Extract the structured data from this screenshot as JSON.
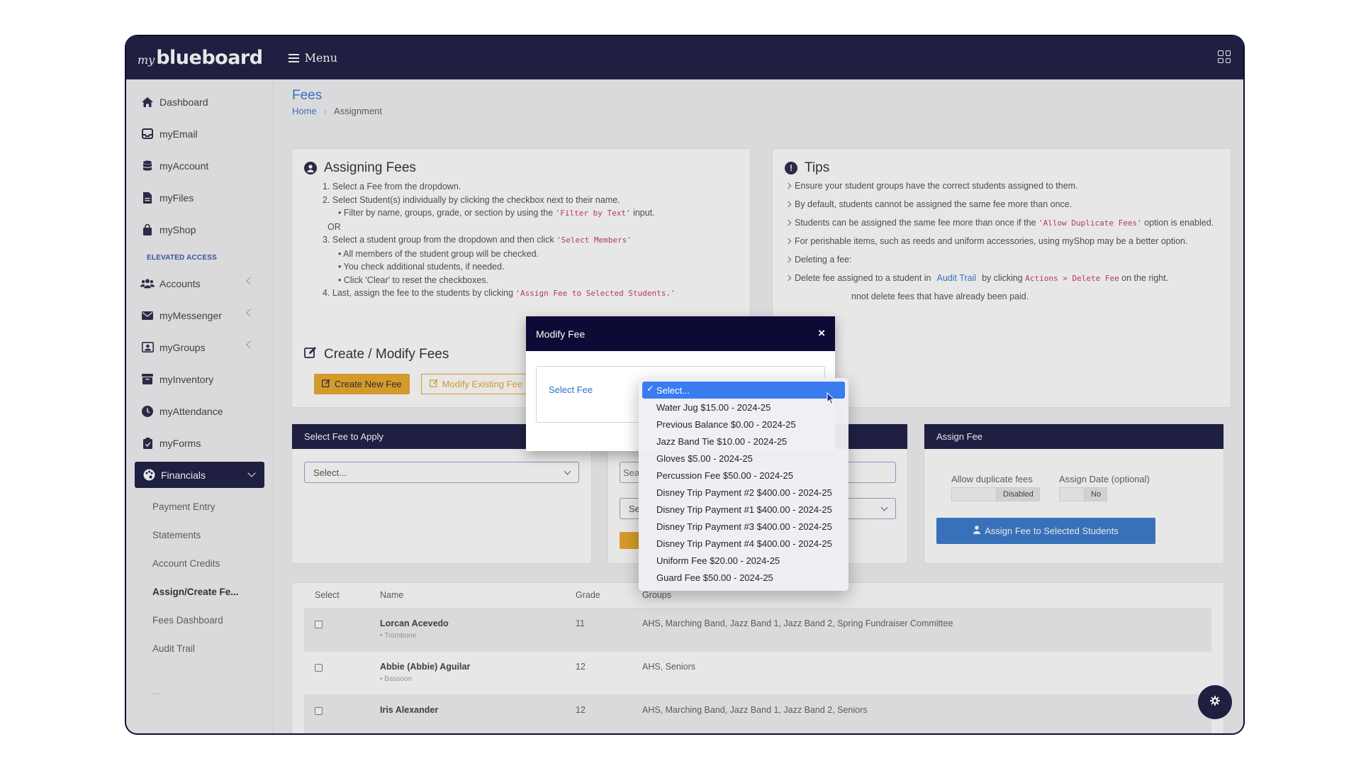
{
  "app": {
    "logo_my": "my",
    "logo_main": "blueboard",
    "menu_label": "Menu"
  },
  "sidebar": {
    "items": [
      {
        "label": "Dashboard",
        "icon": "home-icon"
      },
      {
        "label": "myEmail",
        "icon": "inbox-icon"
      },
      {
        "label": "myAccount",
        "icon": "database-icon"
      },
      {
        "label": "myFiles",
        "icon": "file-icon"
      },
      {
        "label": "myShop",
        "icon": "bag-icon"
      }
    ],
    "elevated_heading": "ELEVATED ACCESS",
    "elevated_items": [
      {
        "label": "Accounts",
        "icon": "users-icon"
      },
      {
        "label": "myMessenger",
        "icon": "envelope-icon"
      },
      {
        "label": "myGroups",
        "icon": "group-icon"
      },
      {
        "label": "myInventory",
        "icon": "archive-icon"
      },
      {
        "label": "myAttendance",
        "icon": "clock-icon"
      },
      {
        "label": "myForms",
        "icon": "clipboard-icon"
      }
    ],
    "active": {
      "label": "Financials",
      "icon": "palette-icon"
    },
    "sub_items": [
      "Payment Entry",
      "Statements",
      "Account Credits",
      "Assign/Create Fe...",
      "Fees Dashboard",
      "Audit Trail"
    ],
    "more": "..."
  },
  "page": {
    "title": "Fees",
    "breadcrumb_home": "Home",
    "breadcrumb_current": "Assignment"
  },
  "assigning": {
    "title": "Assigning Fees",
    "step1": "1. Select a Fee from the dropdown.",
    "step2": "2. Select Student(s) individually by clicking the checkbox next to their name.",
    "step2a_pre": "Filter by name, groups, grade, or section by using the ",
    "step2a_code": "'Filter by Text'",
    "step2a_post": " input.",
    "or": "OR",
    "step3_pre": "3. Select a student group from the dropdown and then click ",
    "step3_code": "'Select Members'",
    "step3a": "All members of the student group will be checked.",
    "step3b": "You check additional students, if needed.",
    "step3c": "Click 'Clear' to reset the checkboxes.",
    "step4_pre": "4. Last, assign the fee to the students by clicking ",
    "step4_code": "'Assign Fee to Selected Students.'"
  },
  "tips": {
    "title": "Tips",
    "t1": "Ensure your student groups have the correct students assigned to them.",
    "t2": "By default, students cannot be assigned the same fee more than once.",
    "t3_pre": "Students can be assigned the same fee more than once if the ",
    "t3_code": "'Allow Duplicate Fees'",
    "t3_post": " option is enabled.",
    "t4": "For perishable items, such as reeds and uniform accessories, using myShop may be a better option.",
    "t5": "Deleting a fee:",
    "t6_pre": "Delete fee assigned to a student in",
    "t6_link": "Audit Trail",
    "t6_mid": "by clicking ",
    "t6_code": "Actions > Delete Fee",
    "t6_post": " on the right.",
    "t7": "nnot delete fees that have already been paid."
  },
  "create": {
    "title": "Create / Modify Fees",
    "new_btn": "Create New Fee",
    "modify_btn": "Modify Existing Fee"
  },
  "apply": {
    "header": "Select Fee to Apply",
    "select_value": "Select..."
  },
  "middle": {
    "search_partial": "Sea",
    "select_partial": "Se"
  },
  "assign": {
    "header": "Assign Fee",
    "dup_label": "Allow duplicate fees",
    "dup_value": "Disabled",
    "date_label": "Assign Date (optional)",
    "date_value": "No",
    "btn": "Assign Fee to Selected Students"
  },
  "table": {
    "headers": [
      "Select",
      "Name",
      "Grade",
      "Groups"
    ],
    "rows": [
      {
        "name": "Lorcan Acevedo",
        "inst": "Trombone",
        "grade": "11",
        "groups": "AHS, Marching Band, Jazz Band 1, Jazz Band 2, Spring Fundraiser Committee"
      },
      {
        "name": "Abbie (Abbie) Aguilar",
        "inst": "Bassoon",
        "grade": "12",
        "groups": "AHS, Seniors"
      },
      {
        "name": "Iris Alexander",
        "inst": "",
        "grade": "12",
        "groups": "AHS, Marching Band, Jazz Band 1, Jazz Band 2, Seniors"
      }
    ]
  },
  "modal": {
    "title": "Modify Fee",
    "close": "×",
    "select_label": "Select Fee"
  },
  "dropdown": {
    "selected": "Select...",
    "options": [
      "Water Jug $15.00 - 2024-25",
      "Previous Balance $0.00 - 2024-25",
      "Jazz Band Tie $10.00 - 2024-25",
      "Gloves $5.00 - 2024-25",
      "Percussion Fee $50.00 - 2024-25",
      "Disney Trip Payment #2 $400.00 - 2024-25",
      "Disney Trip Payment #1 $400.00 - 2024-25",
      "Disney Trip Payment #3 $400.00 - 2024-25",
      "Disney Trip Payment #4 $400.00 - 2024-25",
      "Uniform Fee $20.00 - 2024-25",
      "Guard Fee $50.00 - 2024-25"
    ]
  },
  "colors": {
    "navy": "#0b0b36",
    "accent_blue": "#2a6fc9",
    "orange": "#e8a11c",
    "code_red": "#c0304a"
  }
}
